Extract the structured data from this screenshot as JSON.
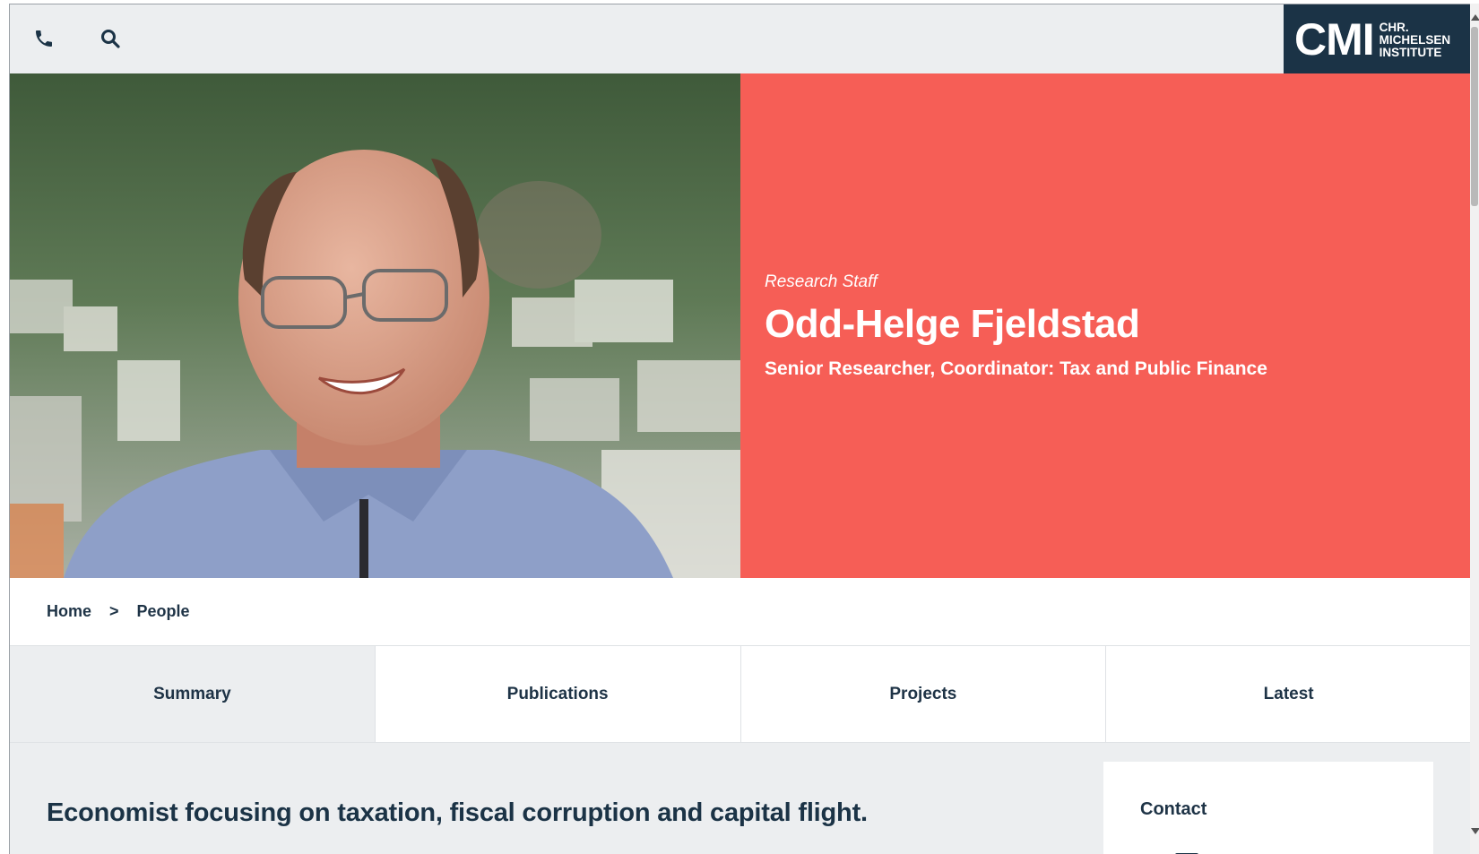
{
  "topbar": {
    "phone_icon": "phone-icon",
    "search_icon": "search-icon",
    "logo": {
      "big": "CMI",
      "line1": "CHR.",
      "line2": "MICHELSEN",
      "line3": "INSTITUTE"
    }
  },
  "hero": {
    "category": "Research Staff",
    "name": "Odd-Helge Fjeldstad",
    "title": "Senior Researcher, Coordinator: Tax and Public Finance",
    "panel_color": "#f65e56"
  },
  "breadcrumb": {
    "home": "Home",
    "separator": ">",
    "current": "People"
  },
  "tabs": [
    {
      "label": "Summary",
      "active": true
    },
    {
      "label": "Publications",
      "active": false
    },
    {
      "label": "Projects",
      "active": false
    },
    {
      "label": "Latest",
      "active": false
    }
  ],
  "content": {
    "lead": "Economist focusing on taxation, fiscal corruption and capital flight.",
    "contact_title": "Contact"
  },
  "colors": {
    "navy": "#1b3346",
    "accent": "#f65e56",
    "light_bg": "#eceef0"
  }
}
